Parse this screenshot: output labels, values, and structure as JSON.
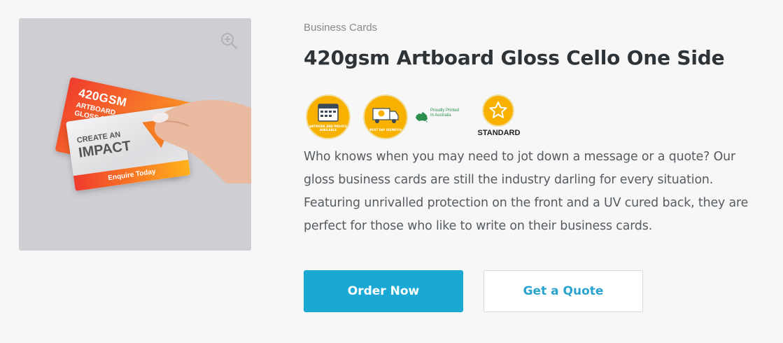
{
  "product": {
    "category": "Business Cards",
    "title": "420gsm Artboard Gloss Cello One Side",
    "description": "Who knows when you may need to jot down a message or a quote? Our gloss business cards are still the industry darling for every situation. Featuring unrivalled protection on the front and a UV cured back, they are perfect for those who like to write on their business cards."
  },
  "image": {
    "card_back_line1": "420GSM",
    "card_back_line2": "ARTBOARD",
    "card_back_line3": "GLOSS 1 SIDE",
    "card_front_line1": "CREATE AN",
    "card_front_line2": "IMPACT",
    "card_front_cta": "Enquire Today",
    "zoom_icon": "zoom-in-icon"
  },
  "badges": {
    "calendar_text": "ARTWORK AND PROOFS AVAILABLE",
    "truck_text": "NEXT DAY DISPATCH",
    "aus_text_1": "Proudly Printed",
    "aus_text_2": "In Australia",
    "standard_label": "STANDARD"
  },
  "actions": {
    "order_label": "Order Now",
    "quote_label": "Get a Quote"
  },
  "colors": {
    "accent": "#1aa9d4",
    "badge_yellow": "#f9b100",
    "title": "#2e3338"
  }
}
